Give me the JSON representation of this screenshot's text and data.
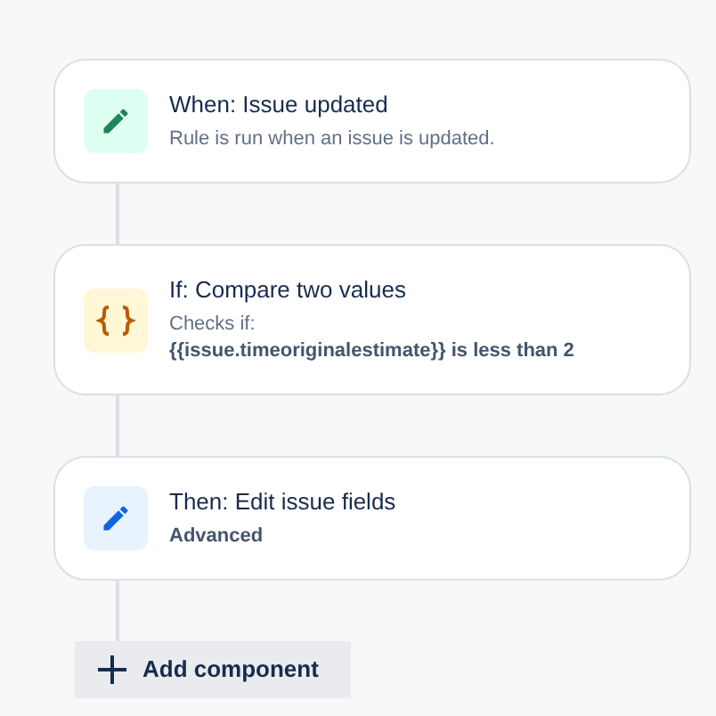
{
  "components": [
    {
      "kind": "trigger",
      "title": "When: Issue updated",
      "lines": [
        {
          "kind": "plain",
          "text": "Rule is run when an issue is updated."
        }
      ]
    },
    {
      "kind": "condition",
      "title": "If: Compare two values",
      "lines": [
        {
          "kind": "plain",
          "text": "Checks if:"
        },
        {
          "kind": "strong",
          "text": "{{issue.timeoriginalestimate}} is less than 2"
        }
      ]
    },
    {
      "kind": "action",
      "title": "Then: Edit issue fields",
      "lines": [
        {
          "kind": "strong",
          "text": "Advanced"
        }
      ]
    }
  ],
  "add_button": {
    "label": "Add component"
  }
}
